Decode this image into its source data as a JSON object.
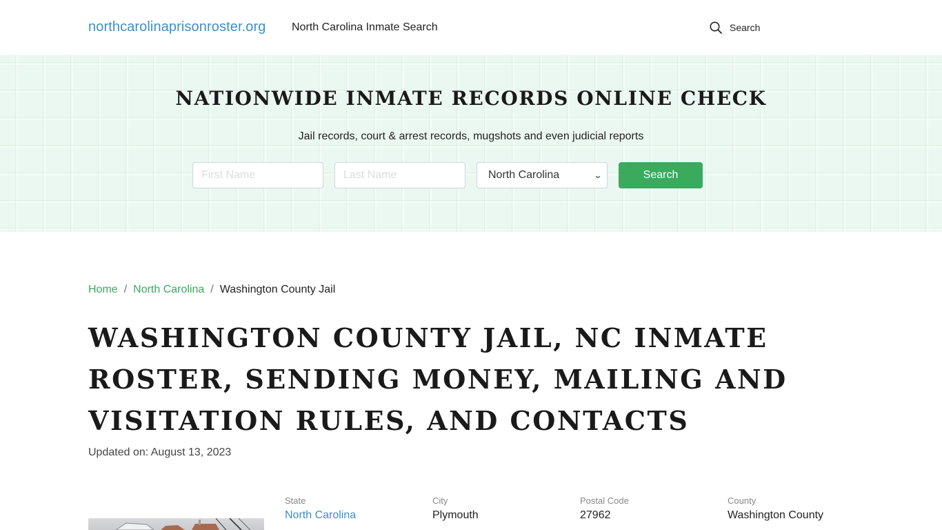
{
  "header": {
    "brand": "northcarolinaprisonroster.org",
    "nav_link": "North Carolina Inmate Search",
    "search_label": "Search",
    "search_icon": "search-icon"
  },
  "hero": {
    "title": "NATIONWIDE INMATE RECORDS ONLINE CHECK",
    "subtitle": "Jail records, court & arrest records, mugshots and even judicial reports",
    "first_name_placeholder": "First Name",
    "first_name_value": "",
    "last_name_placeholder": "Last Name",
    "last_name_value": "",
    "state_selected": "North Carolina",
    "search_button": "Search"
  },
  "breadcrumb": {
    "items": [
      {
        "label": "Home",
        "link": true
      },
      {
        "label": "North Carolina",
        "link": true
      },
      {
        "label": "Washington County Jail",
        "link": false
      }
    ],
    "separator": "/"
  },
  "page": {
    "title": "WASHINGTON COUNTY JAIL, NC INMATE ROSTER, SENDING MONEY, MAILING AND VISITATION RULES, AND CONTACTS",
    "updated": "Updated on: August 13, 2023"
  },
  "info": {
    "state": {
      "label": "State",
      "value": "North Carolina"
    },
    "city": {
      "label": "City",
      "value": "Plymouth"
    },
    "postal_code": {
      "label": "Postal Code",
      "value": "27962"
    },
    "county": {
      "label": "County",
      "value": "Washington County"
    }
  },
  "colors": {
    "brand_blue": "#3d8fc6",
    "accent_green": "#3aaa5d",
    "hero_bg": "#ebf8f1"
  }
}
